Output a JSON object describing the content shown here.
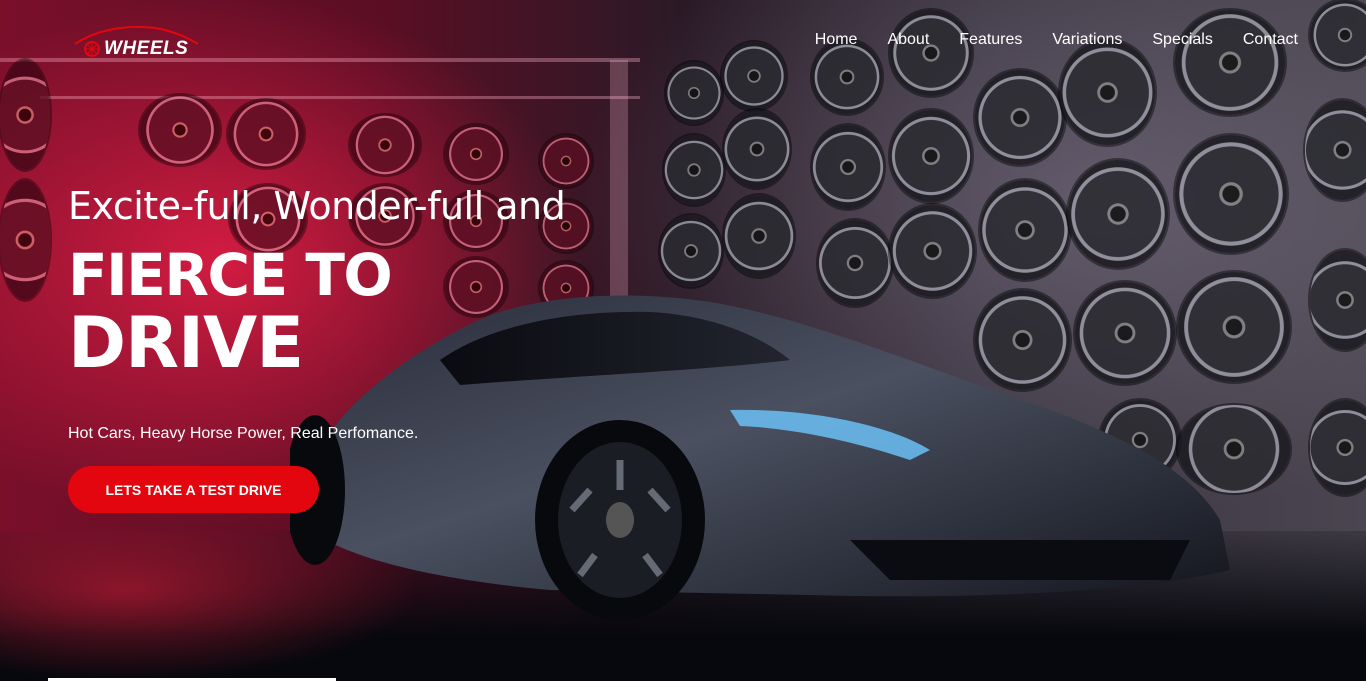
{
  "header": {
    "logo_text": "WHEELS",
    "nav": [
      "Home",
      "About",
      "Features",
      "Variations",
      "Specials",
      "Contact"
    ]
  },
  "hero": {
    "tagline": "Excite-full, Wonder-full and",
    "headline_line1": "FIERCE TO",
    "headline_line2": "DRIVE",
    "subtitle": "Hot Cars, Heavy Horse Power, Real Perfomance.",
    "cta_label": "LETS TAKE A TEST DRIVE"
  },
  "colors": {
    "accent": "#e3060f",
    "text": "#ffffff"
  },
  "icons": {
    "logo": "wheel-icon"
  }
}
